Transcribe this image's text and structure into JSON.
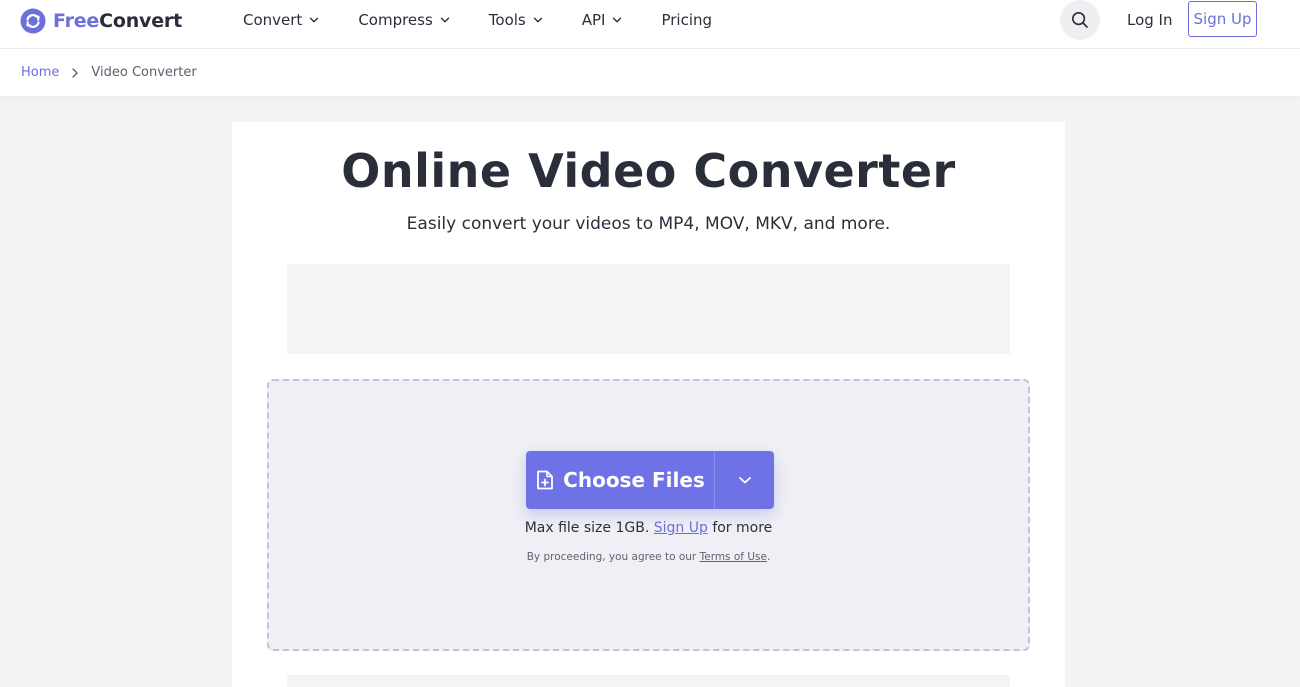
{
  "header": {
    "logo": {
      "part1": "Free",
      "part2": "Convert"
    },
    "nav": [
      {
        "label": "Convert",
        "has_dropdown": true
      },
      {
        "label": "Compress",
        "has_dropdown": true
      },
      {
        "label": "Tools",
        "has_dropdown": true
      },
      {
        "label": "API",
        "has_dropdown": true
      },
      {
        "label": "Pricing",
        "has_dropdown": false
      }
    ],
    "search_icon": "search-icon",
    "login_label": "Log In",
    "signup_label": "Sign Up"
  },
  "breadcrumb": {
    "home": "Home",
    "current": "Video Converter"
  },
  "main": {
    "title": "Online Video Converter",
    "subtitle": "Easily convert your videos to MP4, MOV, MKV, and more.",
    "upload": {
      "choose_label": "Choose Files",
      "max_prefix": "Max file size 1GB.",
      "max_link": "Sign Up",
      "max_suffix": "for more",
      "terms_prefix": "By proceeding, you agree to our",
      "terms_link": "Terms of Use",
      "terms_suffix": "."
    }
  },
  "colors": {
    "brand": "#6c6fd9",
    "button": "#6f72e6",
    "dropzone_bg": "#efeff5",
    "page_bg": "#f3f3f4"
  }
}
